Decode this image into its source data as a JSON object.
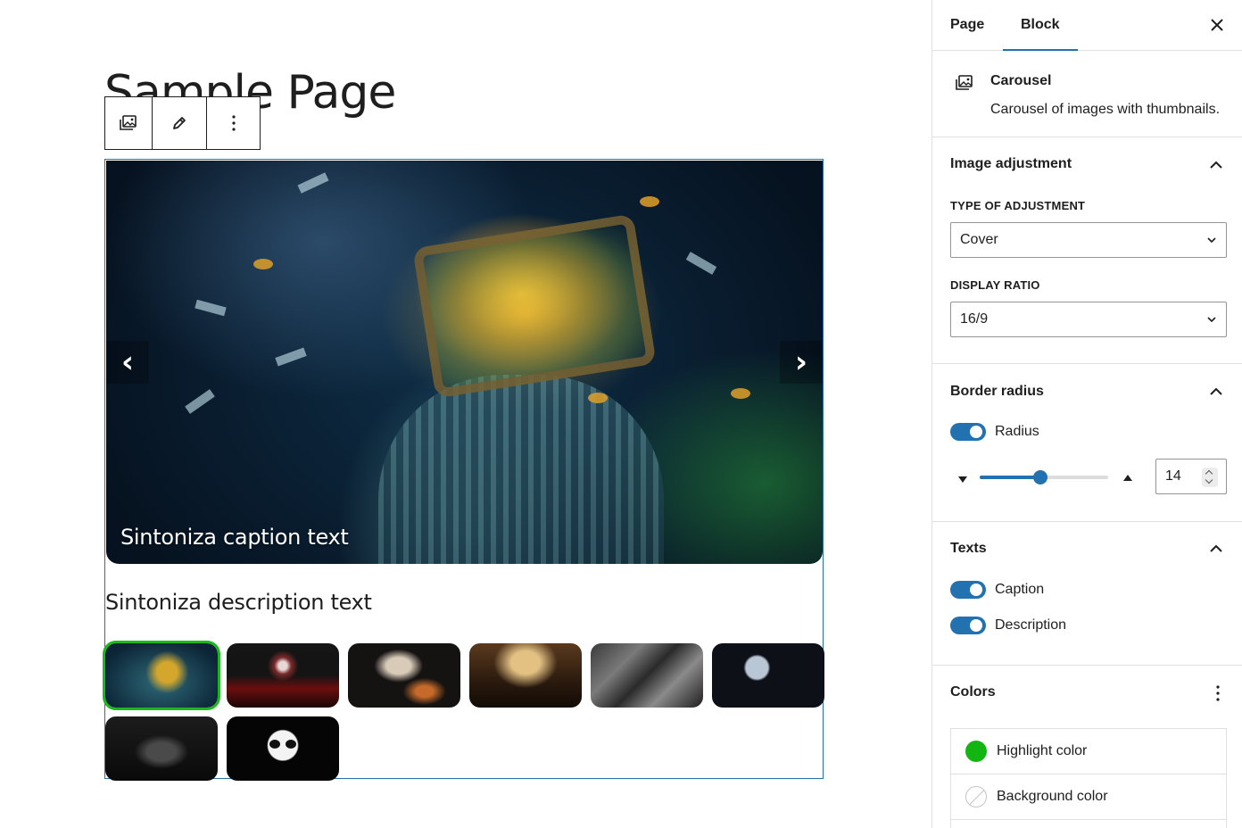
{
  "editor": {
    "page_title": "Sample Page"
  },
  "block_toolbar": {
    "block_icon": "gallery-icon",
    "edit_icon": "pencil-icon",
    "options_icon": "more-vertical-icon"
  },
  "carousel": {
    "caption": "Sintoniza caption text",
    "description": "Sintoniza description text",
    "prev_icon": "chevron-left-icon",
    "next_icon": "chevron-right-icon",
    "prev_glyph": "‹",
    "next_glyph": "›",
    "thumbnail_count": 8,
    "active_thumbnail": 1,
    "highlight_color": "#1eb71e",
    "selection_border_color": "#2271b1"
  },
  "sidebar": {
    "tabs": [
      {
        "label": "Page",
        "active": false
      },
      {
        "label": "Block",
        "active": true
      }
    ],
    "close_icon": "close-icon",
    "block_card": {
      "name": "Carousel",
      "description": "Carousel of images with thumbnails.",
      "icon": "gallery-icon"
    },
    "image_adjustment": {
      "title": "Image adjustment",
      "type_label": "TYPE OF ADJUSTMENT",
      "type_value": "Cover",
      "ratio_label": "DISPLAY RATIO",
      "ratio_value": "16/9"
    },
    "border_radius": {
      "title": "Border radius",
      "toggle_label": "Radius",
      "toggle_on": true,
      "value": "14",
      "slider_fraction": 0.47
    },
    "texts": {
      "title": "Texts",
      "caption_label": "Caption",
      "caption_on": true,
      "description_label": "Description",
      "description_on": true
    },
    "colors": {
      "title": "Colors",
      "highlight_label": "Highlight color",
      "highlight_value": "#12b512",
      "background_label": "Background color"
    }
  }
}
